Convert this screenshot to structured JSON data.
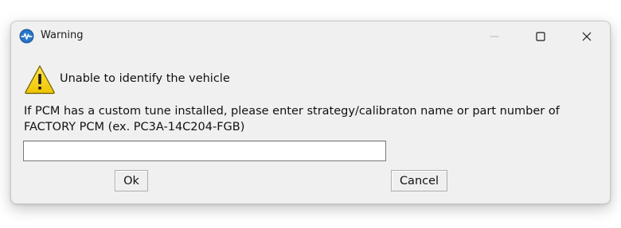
{
  "window": {
    "title": "Warning",
    "app_icon": "app-pulse-icon",
    "controls": [
      "minimize-icon",
      "maximize-icon",
      "close-icon"
    ]
  },
  "content": {
    "icon": "warning-triangle-icon",
    "heading": "Unable to identify the vehicle",
    "message_line1": "If PCM has a custom tune installed, please enter strategy/calibraton name or part number of",
    "message_line2": "FACTORY PCM (ex. PC3A-14C204-FGB)",
    "input_value": ""
  },
  "buttons": {
    "ok": "Ok",
    "cancel": "Cancel"
  },
  "colors": {
    "dialog_bg": "#f0f0f0",
    "warning_yellow": "#f5d400",
    "app_icon_blue": "#1f5fa8"
  }
}
